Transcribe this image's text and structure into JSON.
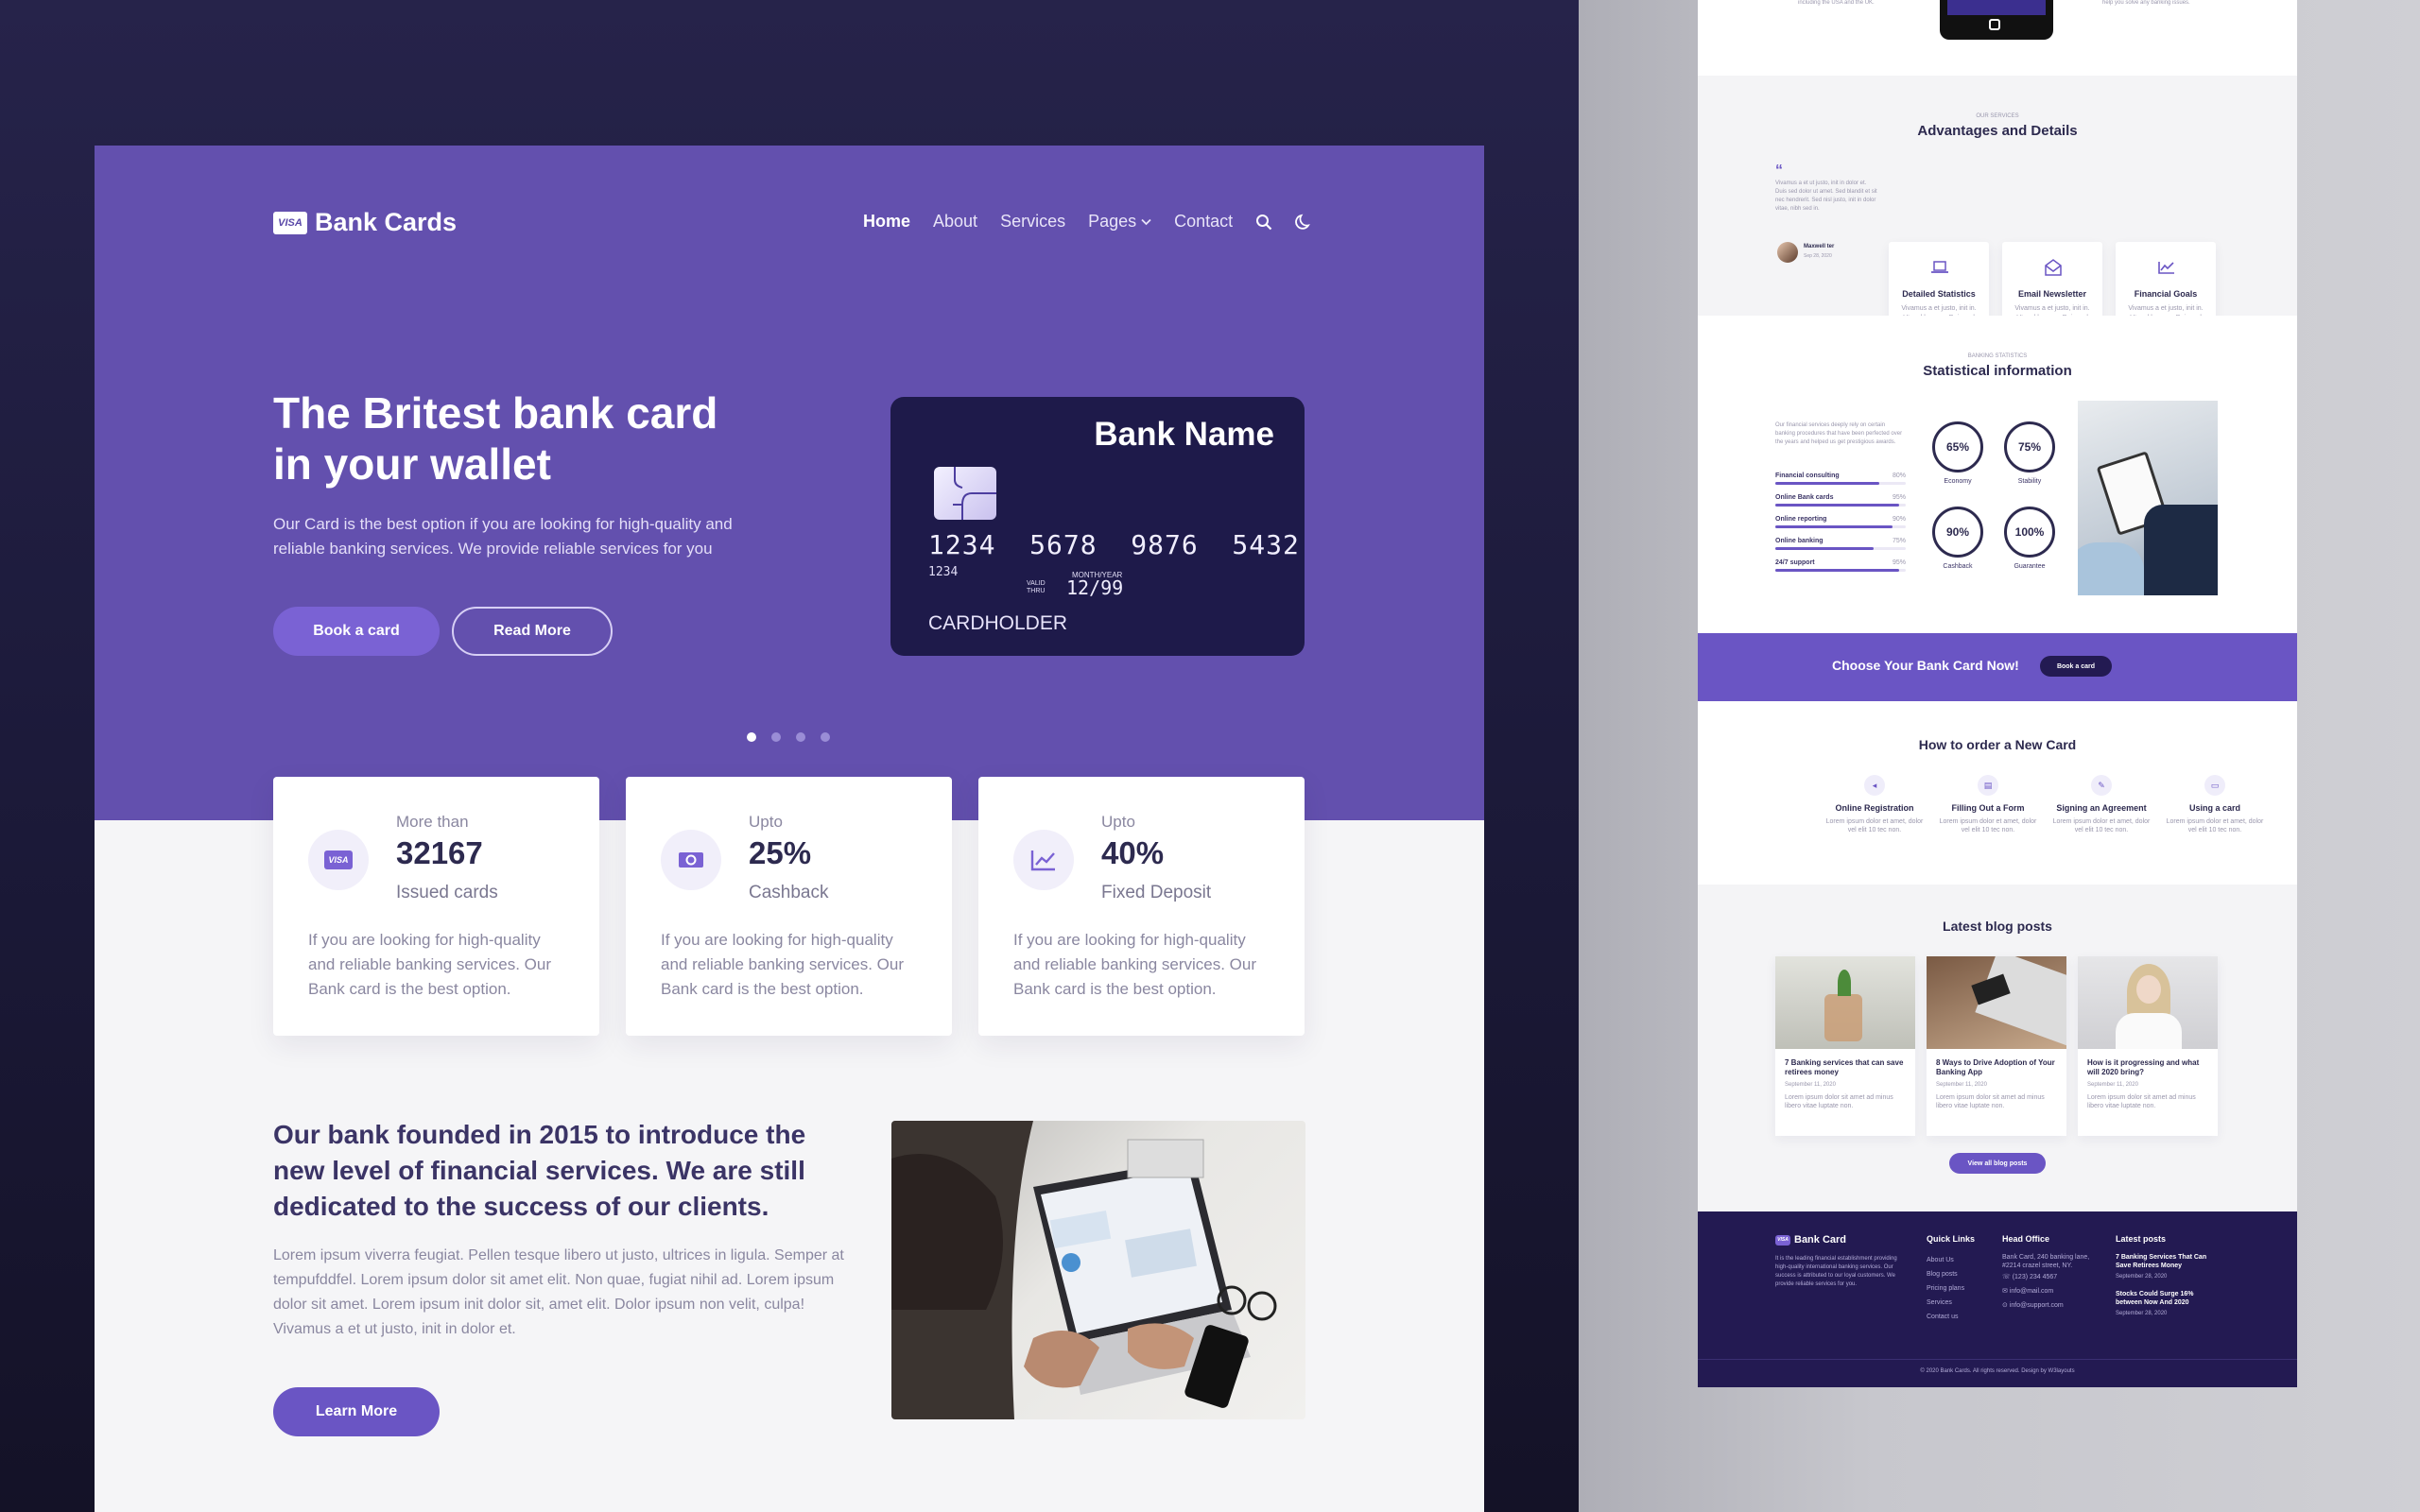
{
  "hero": {
    "brand_badge": "VISA",
    "brand": "Bank Cards",
    "nav": [
      "Home",
      "About",
      "Services",
      "Pages",
      "Contact"
    ],
    "title_line1": "The Britest bank card",
    "title_line2": "in your wallet",
    "subtitle": "Our Card is the best option if you are looking for high-quality and reliable banking services. We provide reliable services for you",
    "btn_primary": "Book a card",
    "btn_secondary": "Read More",
    "card": {
      "bank_name": "Bank Name",
      "number": "1234  5678  9876  5432",
      "small_number": "1234",
      "valid_label": "VALID THRU",
      "month_label": "MONTH/YEAR",
      "expiry": "12/99",
      "holder": "CARDHOLDER"
    },
    "slider_active": 0
  },
  "stats": [
    {
      "pre": "More than",
      "value": "32167",
      "label": "Issued cards",
      "text": "If you are looking for high-quality and reliable banking services. Our Bank card is the best option.",
      "icon": "visa-card-icon"
    },
    {
      "pre": "Upto",
      "value": "25%",
      "label": "Cashback",
      "text": "If you are looking for high-quality and reliable banking services. Our Bank card is the best option.",
      "icon": "money-icon"
    },
    {
      "pre": "Upto",
      "value": "40%",
      "label": "Fixed Deposit",
      "text": "If you are looking for high-quality and reliable banking services. Our Bank card is the best option.",
      "icon": "chart-line-icon"
    }
  ],
  "about": {
    "heading": "Our bank founded in 2015 to introduce the new level of financial services. We are still dedicated to the success of our clients.",
    "text": "Lorem ipsum viverra feugiat. Pellen tesque libero ut justo, ultrices in ligula. Semper at tempufddfel. Lorem ipsum dolor sit amet elit. Non quae, fugiat nihil ad. Lorem ipsum dolor sit amet. Lorem ipsum init dolor sit, amet elit. Dolor ipsum non velit, culpa! Vivamus a et ut justo, init in dolor et.",
    "button": "Learn More"
  },
  "right": {
    "top_left_text": "including the USA and the UK.",
    "top_right_text": "help you solve any banking issues.",
    "services": {
      "eyebrow": "OUR SERVICES",
      "title": "Advantages and Details",
      "quote": "Vivamus a et ut justo, init in dolor et. Duis sed dolor ut amet. Sed blandit et sit nec hendrerit. Sed nisl justo, init in dolor vitae, nibh sed in.",
      "author": "Maxwell ter",
      "author_date": "Sep 28, 2020",
      "cards": [
        {
          "title": "Detailed Statistics",
          "text": "Vivamus a et justo, init in. Ut sed leo nec. Duis sed dolor et."
        },
        {
          "title": "Email Newsletter",
          "text": "Vivamus a et justo, init in. Ut sed leo nec. Duis sed dolor et."
        },
        {
          "title": "Financial Goals",
          "text": "Vivamus a et justo, init in. Ut sed leo nec. Duis sed dolor et."
        }
      ]
    },
    "statistics": {
      "eyebrow": "BANKING STATISTICS",
      "title": "Statistical information",
      "intro": "Our financial services deeply rely on certain banking procedures that have been perfected over the years and helped us get prestigious awards.",
      "bars": [
        {
          "label": "Financial consulting",
          "value": "80%",
          "pct": 80
        },
        {
          "label": "Online Bank cards",
          "value": "95%",
          "pct": 95
        },
        {
          "label": "Online reporting",
          "value": "90%",
          "pct": 90
        },
        {
          "label": "Online banking",
          "value": "75%",
          "pct": 75
        },
        {
          "label": "24/7 support",
          "value": "95%",
          "pct": 95
        }
      ],
      "rings": [
        {
          "value": "65%",
          "label": "Economy"
        },
        {
          "value": "75%",
          "label": "Stability"
        },
        {
          "value": "90%",
          "label": "Cashback"
        },
        {
          "value": "100%",
          "label": "Guarantee"
        }
      ]
    },
    "cta": {
      "text": "Choose Your Bank Card Now!",
      "button": "Book a card"
    },
    "order": {
      "title": "How to order a New Card",
      "steps": [
        {
          "title": "Online Registration",
          "text": "Lorem ipsum dolor et amet, dolor vel elit 10 tec non."
        },
        {
          "title": "Filling Out a Form",
          "text": "Lorem ipsum dolor et amet, dolor vel elit 10 tec non."
        },
        {
          "title": "Signing an Agreement",
          "text": "Lorem ipsum dolor et amet, dolor vel elit 10 tec non."
        },
        {
          "title": "Using a card",
          "text": "Lorem ipsum dolor et amet, dolor vel elit 10 tec non."
        }
      ]
    },
    "blog": {
      "title": "Latest blog posts",
      "posts": [
        {
          "title": "7 Banking services that can save retirees money",
          "date": "September 11, 2020",
          "text": "Lorem ipsum dolor sit amet ad minus libero vitae luptate non."
        },
        {
          "title": "8 Ways to Drive Adoption of Your Banking App",
          "date": "September 11, 2020",
          "text": "Lorem ipsum dolor sit amet ad minus libero vitae luptate non."
        },
        {
          "title": "How is it progressing and what will 2020 bring?",
          "date": "September 11, 2020",
          "text": "Lorem ipsum dolor sit amet ad minus libero vitae luptate non."
        }
      ],
      "button": "View all blog posts"
    },
    "footer": {
      "brand": "Bank Card",
      "about": "It is the leading financial establishment providing high-quality international banking services. Our success is attributed to our loyal customers. We provide reliable services for you.",
      "quick_title": "Quick Links",
      "quick": [
        "About Us",
        "Blog posts",
        "Pricing plans",
        "Services",
        "Contact us"
      ],
      "office_title": "Head Office",
      "office": [
        "Bank Card, 240 banking lane,",
        "#2214 crazel street, NY.",
        "(123) 234 4567",
        "info@mail.com",
        "info@support.com"
      ],
      "posts_title": "Latest posts",
      "posts": [
        {
          "title": "7 Banking Services That Can Save Retirees Money",
          "date": "September 28, 2020"
        },
        {
          "title": "Stocks Could Surge 16% between Now And 2020",
          "date": "September 28, 2020"
        }
      ],
      "copyright": "© 2020 Bank Cards. All rights reserved. Design by W3layouts"
    }
  },
  "colors": {
    "primary": "#6350ae",
    "dark": "#1e1a4a",
    "footer": "#231a52",
    "button": "#6a55c4"
  }
}
